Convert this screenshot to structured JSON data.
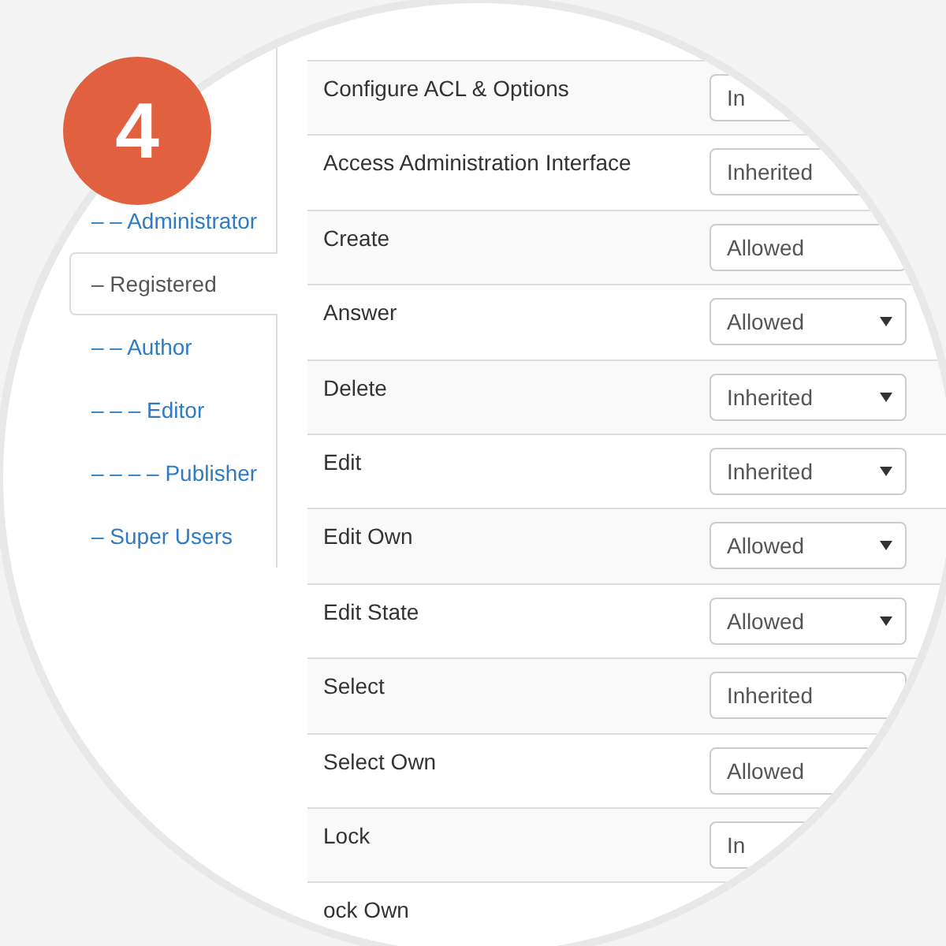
{
  "step_badge": {
    "number": "4"
  },
  "group_tabs": [
    {
      "label": "– – Administrator",
      "selected": false
    },
    {
      "label": "– Registered",
      "selected": true
    },
    {
      "label": "– – Author",
      "selected": false
    },
    {
      "label": "– – – Editor",
      "selected": false
    },
    {
      "label": "– – – – Publisher",
      "selected": false
    },
    {
      "label": "– Super Users",
      "selected": false
    }
  ],
  "permissions": [
    {
      "action": "Configure ACL & Options",
      "setting": "In"
    },
    {
      "action": "Access Administration Interface",
      "setting": "Inherited"
    },
    {
      "action": "Create",
      "setting": "Allowed"
    },
    {
      "action": "Answer",
      "setting": "Allowed"
    },
    {
      "action": "Delete",
      "setting": "Inherited"
    },
    {
      "action": "Edit",
      "setting": "Inherited"
    },
    {
      "action": "Edit Own",
      "setting": "Allowed"
    },
    {
      "action": "Edit State",
      "setting": "Allowed"
    },
    {
      "action": "Select",
      "setting": "Inherited"
    },
    {
      "action": "Select Own",
      "setting": "Allowed"
    },
    {
      "action": "Lock",
      "setting": "In"
    },
    {
      "action": "ock Own"
    }
  ]
}
